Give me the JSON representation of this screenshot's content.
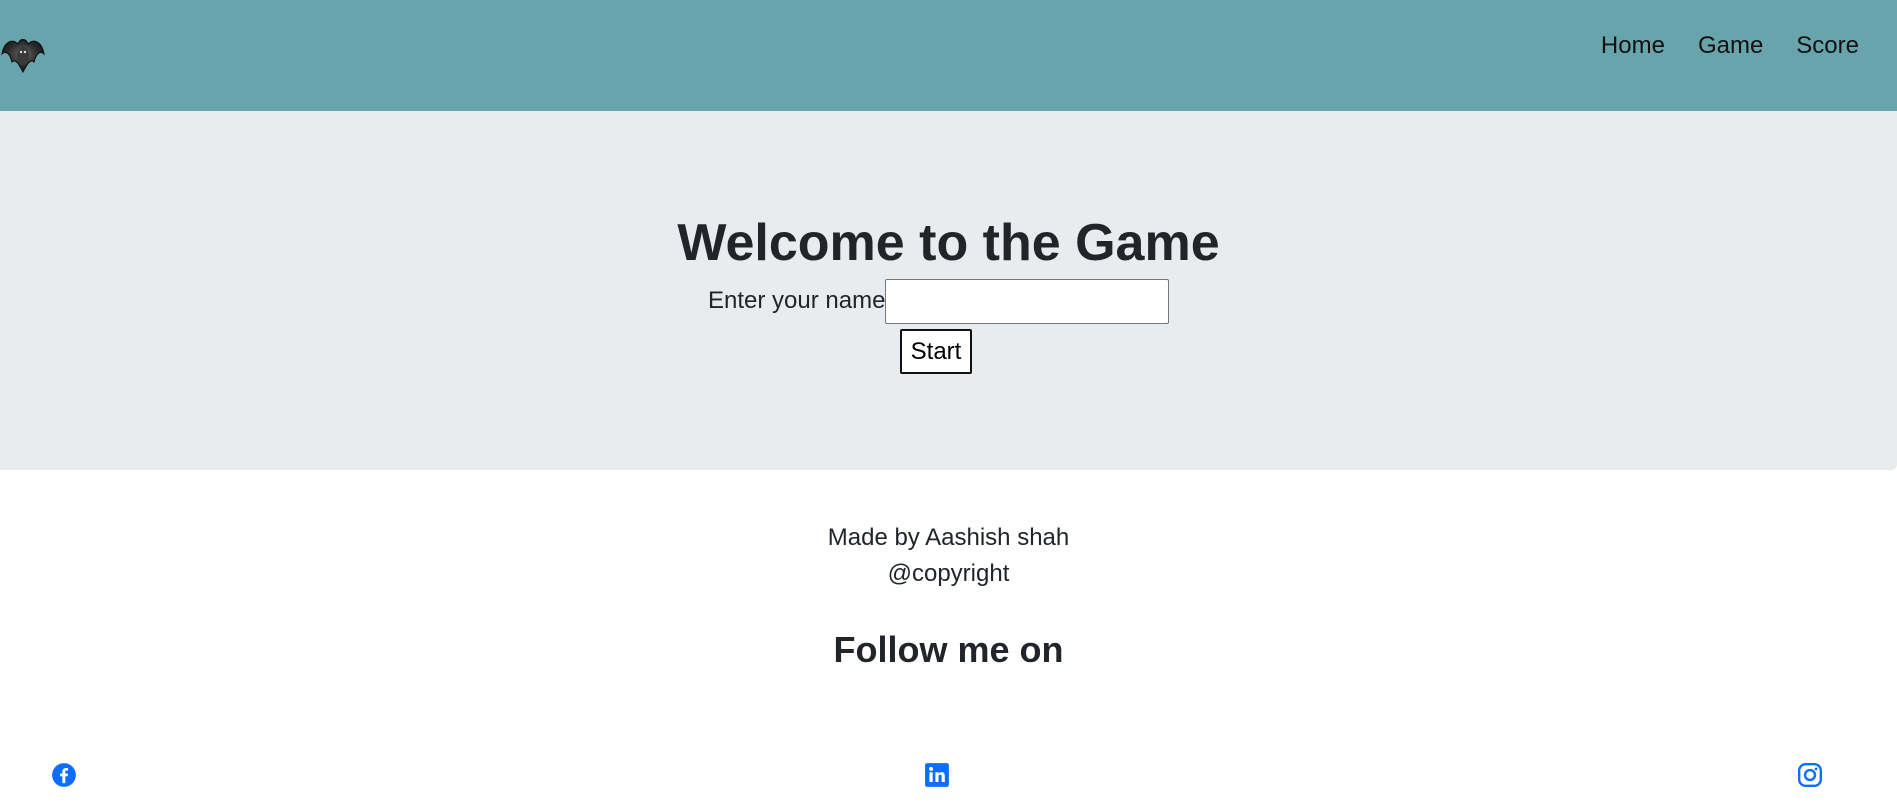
{
  "nav": {
    "logo_icon": "bat-logo-icon",
    "links": [
      {
        "label": "Home"
      },
      {
        "label": "Game"
      },
      {
        "label": "Score"
      }
    ]
  },
  "hero": {
    "title": "Welcome to the Game",
    "name_label": "Enter your name",
    "name_value": "",
    "name_placeholder": "",
    "start_label": "Start"
  },
  "footer": {
    "made_by": "Made by Aashish shah",
    "copyright": "@copyright",
    "follow_title": "Follow me on",
    "social": [
      {
        "icon": "facebook-icon"
      },
      {
        "icon": "linkedin-icon"
      },
      {
        "icon": "instagram-icon"
      }
    ]
  },
  "colors": {
    "navbar": "#67a4ab",
    "jumbotron": "#e9ecef",
    "social_icon": "#0d6efd"
  }
}
